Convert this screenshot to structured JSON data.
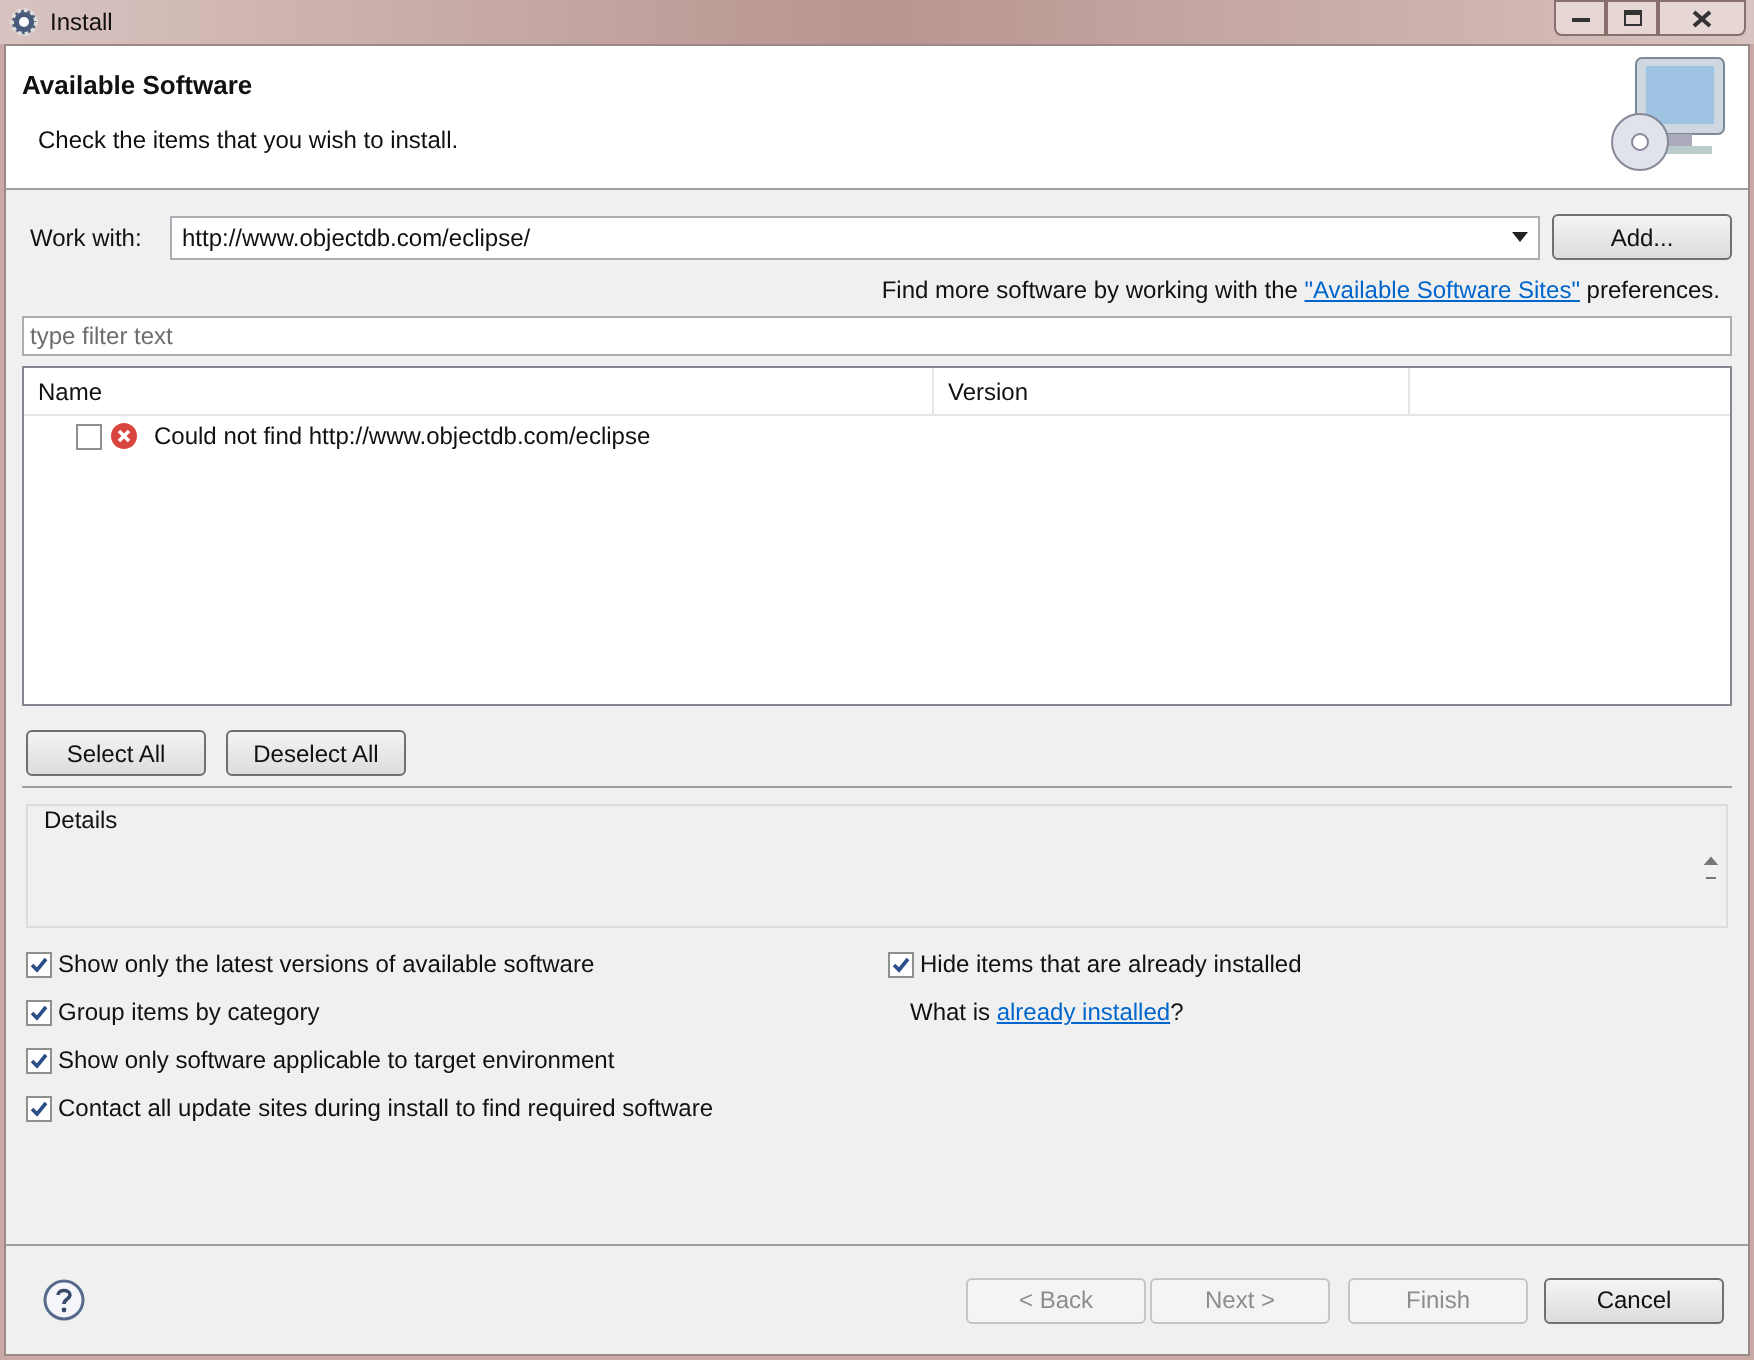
{
  "window": {
    "title": "Install"
  },
  "header": {
    "title": "Available Software",
    "subtitle": "Check the items that you wish to install."
  },
  "work_with": {
    "label": "Work with:",
    "value": "http://www.objectdb.com/eclipse/",
    "add_button": "Add..."
  },
  "sites_hint": {
    "before": "Find more software by working with the ",
    "link": "\"Available Software Sites\"",
    "after": " preferences."
  },
  "filter": {
    "placeholder": "type filter text"
  },
  "table": {
    "columns": [
      "Name",
      "Version"
    ],
    "rows": [
      {
        "name": "Could not find http://www.objectdb.com/eclipse",
        "checked": false,
        "kind": "error"
      }
    ]
  },
  "selection_buttons": [
    "Select All",
    "Deselect All"
  ],
  "details": {
    "label": "Details"
  },
  "options_left": [
    {
      "label": "Show only the latest versions of available software",
      "checked": true
    },
    {
      "label": "Group items by category",
      "checked": true
    },
    {
      "label": "Show only software applicable to target environment",
      "checked": true
    },
    {
      "label": "Contact all update sites during install to find required software",
      "checked": true
    }
  ],
  "options_right": [
    {
      "label": "Hide items that are already installed",
      "checked": true
    }
  ],
  "installed_hint": {
    "before": "What is ",
    "link": "already installed",
    "after": "?"
  },
  "footer_buttons": [
    {
      "label": "< Back",
      "disabled": true
    },
    {
      "label": "Next >",
      "disabled": true
    },
    {
      "label": "Finish",
      "disabled": true
    },
    {
      "label": "Cancel",
      "disabled": false
    }
  ]
}
